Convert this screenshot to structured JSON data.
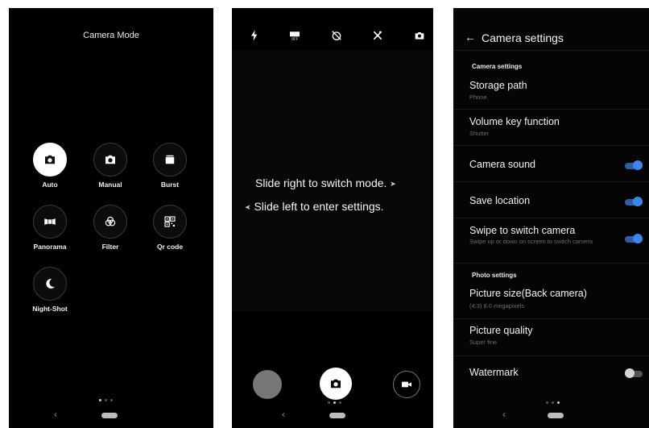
{
  "mode_screen": {
    "title": "Camera Mode",
    "modes": [
      {
        "label": "Auto",
        "icon": "camera-icon",
        "selected": true
      },
      {
        "label": "Manual",
        "icon": "camera-icon"
      },
      {
        "label": "Burst",
        "icon": "burst-icon"
      },
      {
        "label": "Panorama",
        "icon": "panorama-icon"
      },
      {
        "label": "Filter",
        "icon": "filter-icon"
      },
      {
        "label": "Qr code",
        "icon": "qr-code-icon"
      },
      {
        "label": "Night-Shot",
        "icon": "moon-icon"
      }
    ]
  },
  "viewfinder_screen": {
    "top_icons": [
      "flash-icon",
      "hdr-off-icon",
      "timer-off-icon",
      "scene-icon",
      "switch-camera-icon"
    ],
    "hint_right": "Slide right to switch mode.",
    "hint_left": "Slide left to enter settings."
  },
  "settings_screen": {
    "back_arrow": "←",
    "title": "Camera settings",
    "camera_section": "Camera settings",
    "photo_section": "Photo settings",
    "rows": [
      {
        "title": "Storage path",
        "subtitle": "Phone"
      },
      {
        "title": "Volume key function",
        "subtitle": "Shutter"
      },
      {
        "title": "Camera sound",
        "toggle": true
      },
      {
        "title": "Save location",
        "toggle": true
      },
      {
        "title": "Swipe to switch camera",
        "subtitle": "Swipe up or down on screen to switch camera",
        "toggle": true
      },
      {
        "title": "Picture size(Back camera)",
        "subtitle": "(4:3) 8.0 megapixels"
      },
      {
        "title": "Picture quality",
        "subtitle": "Super fine"
      },
      {
        "title": "Watermark",
        "toggle": false
      }
    ]
  },
  "nav": {
    "back": "‹"
  },
  "colors": {
    "toggle_on": "#3d86ee",
    "background": "#000000"
  }
}
